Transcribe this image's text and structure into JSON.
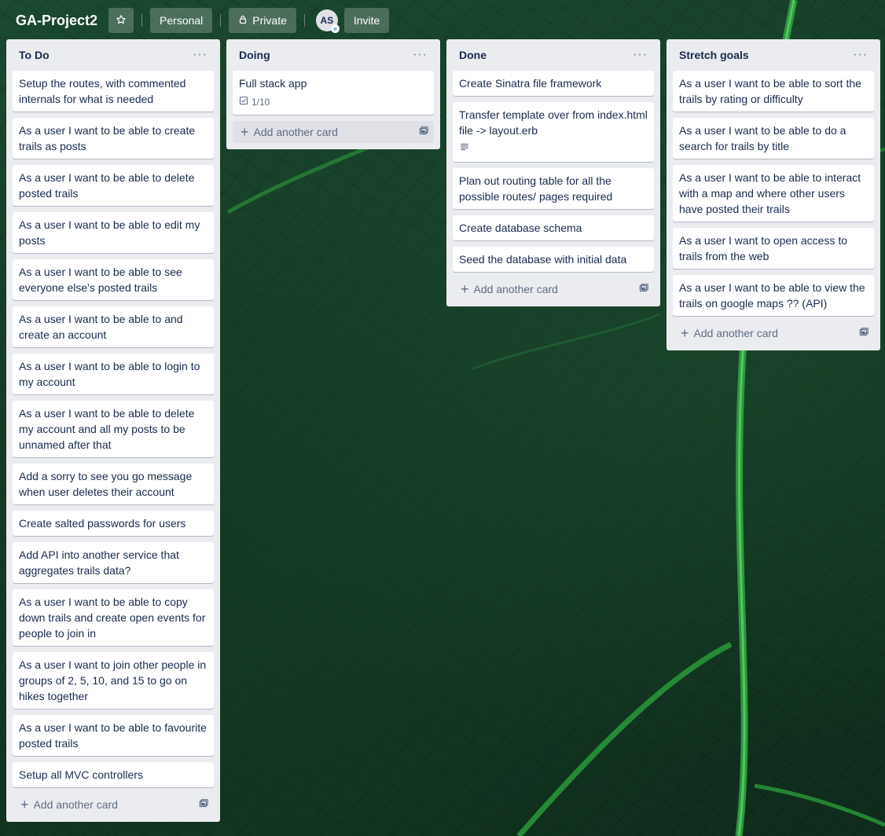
{
  "board": {
    "title": "GA-Project2",
    "visibility_team": "Personal",
    "visibility_privacy": "Private",
    "avatar_initials": "AS",
    "invite_label": "Invite"
  },
  "lists": [
    {
      "title": "To Do",
      "cards": [
        "Setup the routes, with commented internals for what is needed",
        "As a user I want to be able to create trails as posts",
        "As a user I want to be able to delete posted trails",
        "As a user I want to be able to edit my posts",
        "As a user I want to be able to see everyone else's posted trails",
        "As a user I want to be able to and create an account",
        "As a user I want to be able to login to my account",
        "As a user I want to be able to delete my account and all my posts to be unnamed after that",
        "Add a sorry to see you go message when user deletes their account",
        "Create salted passwords for users",
        "Add API into another service that aggregates trails data?",
        "As a user I want to be able to copy down trails and create open events for people to join in",
        "As a user I want to join other people in groups of 2, 5, 10, and 15 to go on hikes together",
        "As a user I want to be able to favourite posted trails",
        "Setup all MVC controllers"
      ],
      "add_label": "Add another card"
    },
    {
      "title": "Doing",
      "cards": [
        "Full stack app"
      ],
      "checklist_badge": "1/10",
      "add_label": "Add another card"
    },
    {
      "title": "Done",
      "cards": [
        "Create Sinatra file framework",
        "Transfer template over from index.html file -> layout.erb",
        "Plan out routing table for all the possible routes/ pages required",
        "Create database schema",
        "Seed the database with initial data"
      ],
      "add_label": "Add another card"
    },
    {
      "title": "Stretch goals",
      "cards": [
        "As a user I want to be able to sort the trails by rating or difficulty",
        "As a user I want to be able to do a search for trails by title",
        "As a user I want to be able to interact with a map and where other users have posted their trails",
        "As a user I want to open access to trails from the web",
        "As a user I want to be able to view the trails on google maps ?? (API)"
      ],
      "add_label": "Add another card"
    }
  ],
  "icons": {
    "star": "star-icon",
    "lock": "lock-icon",
    "menu": "more-horizontal-icon",
    "template": "card-template-icon",
    "checklist": "checklist-icon",
    "description": "description-icon"
  }
}
